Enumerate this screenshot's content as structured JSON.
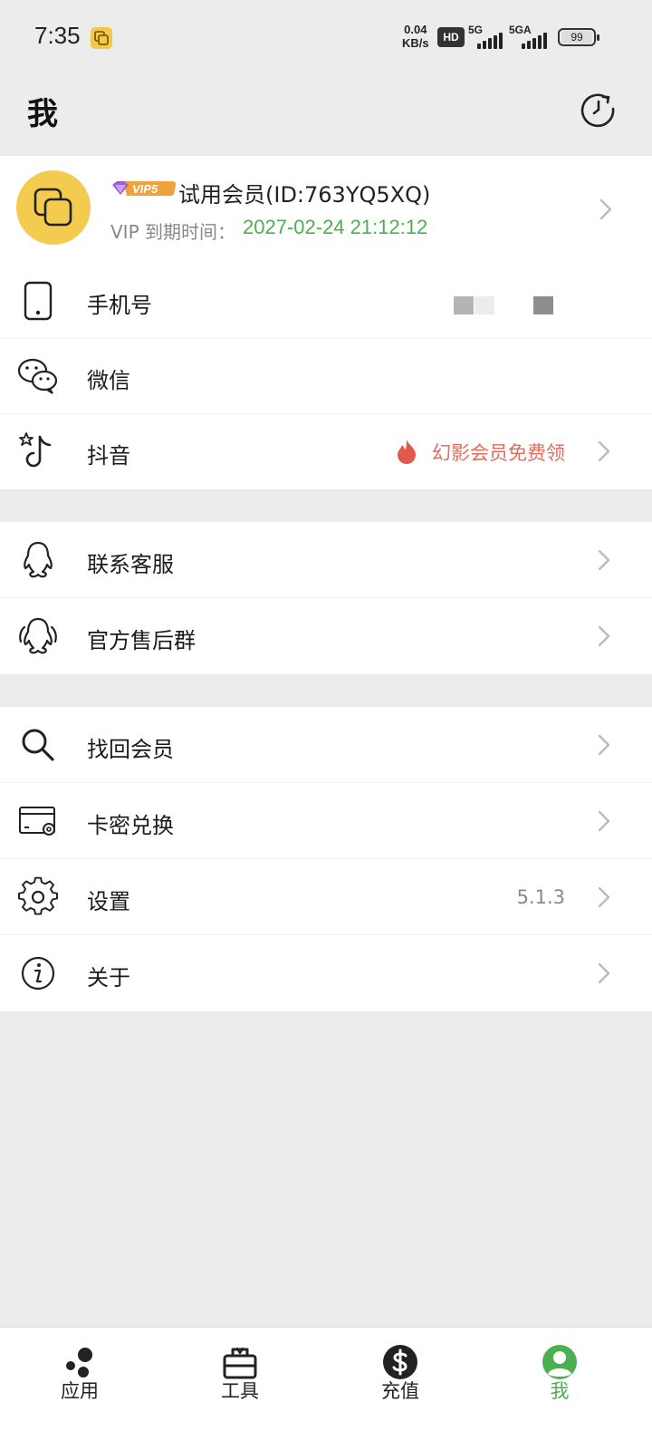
{
  "status_bar": {
    "time": "7:35",
    "speed_value": "0.04",
    "speed_unit": "KB/s",
    "hd_label": "HD",
    "sim1_network": "5G",
    "sim2_network": "5GA",
    "battery": "99"
  },
  "header": {
    "title": "我"
  },
  "profile": {
    "vip_badge": "VIP5",
    "member_name": "试用会员(ID:763YQ5XQ)",
    "expire_label": "VIP 到期时间：",
    "expire_value": "2027-02-24 21:12:12"
  },
  "account_rows": [
    {
      "label": "手机号",
      "icon": "phone-icon"
    },
    {
      "label": "微信",
      "icon": "wechat-icon"
    },
    {
      "label": "抖音",
      "icon": "douyin-icon",
      "promo": "幻影会员免费领"
    }
  ],
  "support_rows": [
    {
      "label": "联系客服",
      "icon": "qq-icon"
    },
    {
      "label": "官方售后群",
      "icon": "qq-group-icon"
    }
  ],
  "misc_rows": [
    {
      "label": "找回会员",
      "icon": "search-icon"
    },
    {
      "label": "卡密兑换",
      "icon": "card-icon"
    },
    {
      "label": "设置",
      "icon": "gear-icon",
      "value": "5.1.3"
    },
    {
      "label": "关于",
      "icon": "info-icon"
    }
  ],
  "bottom_nav": [
    {
      "label": "应用",
      "icon": "apps-icon",
      "active": false
    },
    {
      "label": "工具",
      "icon": "toolbox-icon",
      "active": false
    },
    {
      "label": "充值",
      "icon": "dollar-icon",
      "active": false
    },
    {
      "label": "我",
      "icon": "profile-icon",
      "active": true
    }
  ],
  "colors": {
    "accent_green": "#4caf50",
    "avatar_yellow": "#f2cb4f",
    "promo_red": "#e06d5e",
    "background": "#ececec"
  }
}
